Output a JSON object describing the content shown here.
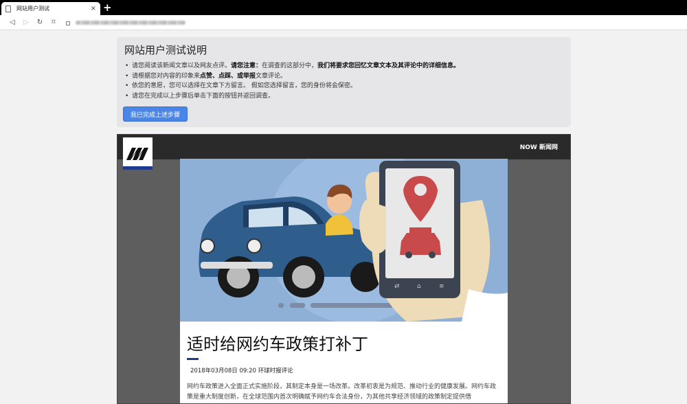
{
  "browser": {
    "tab_title": "网站用户测试",
    "tab_close": "×",
    "new_tab": "+",
    "back": "◁",
    "forward": "▷",
    "reload": "↻",
    "bookmark": "⌑"
  },
  "panel": {
    "title": "网站用户测试说明",
    "items": [
      {
        "pre": "请您阅读该新闻文章以及网友点评。",
        "bold": "请您注意：",
        "post": "在调查的这部分中，",
        "bold2": "我们将要求您回忆文章文本及其评论中的详细信息。"
      },
      {
        "pre": "请根据您对内容的印象来",
        "bold": "点赞、点踩、或举报",
        "post": "文章评论。",
        "bold2": ""
      },
      {
        "pre": "依您的意愿，您可以选择在文章下方留言。 假如您选择留言，您的身份将会保密。",
        "bold": "",
        "post": "",
        "bold2": ""
      },
      {
        "pre": "请您在完成以上步骤后单击下面的按钮并返回调查。",
        "bold": "",
        "post": "",
        "bold2": ""
      }
    ],
    "button_label": "我已完成上述步骤"
  },
  "news": {
    "brand": "NOW 新闻网",
    "headline": "适时给网约车政策打补丁",
    "byline": "2018年03月08日 09:20 环球时报评论",
    "body": "网约车政策进入全面正式实施阶段，其制定本身是一场改革。改革初衷是为规范、推动行业的健康发展。网约车政策是重大制度创新，在全球范围内首次明确赋予网约车合法身份，为其他共享经济领域的政策制定提供借"
  },
  "colors": {
    "accent_button": "#4a86e8",
    "logo_bar": "#1f3a8a",
    "hero_bg": "#8fb0d6"
  }
}
